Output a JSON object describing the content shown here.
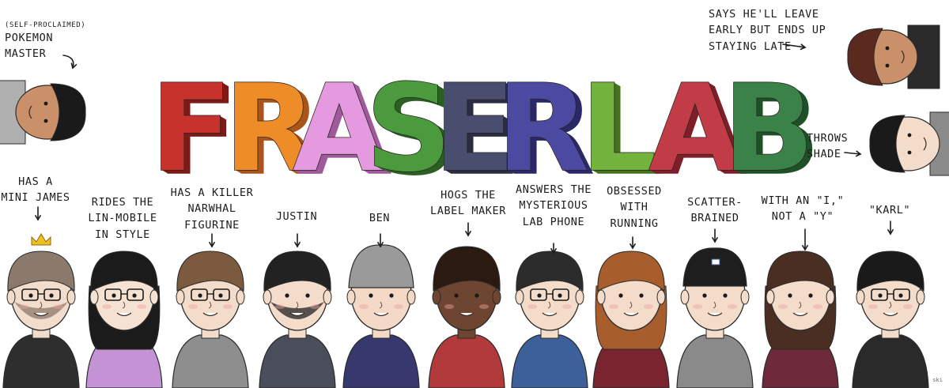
{
  "title": {
    "letters": [
      {
        "ch": "F",
        "color": "#c8322c",
        "side": "#7e1a17"
      },
      {
        "ch": "R",
        "color": "#ee8c28",
        "side": "#a9551a"
      },
      {
        "ch": "A",
        "color": "#e59ae0",
        "side": "#9e5b9b"
      },
      {
        "ch": "S",
        "color": "#4c9a3e",
        "side": "#2c5f24"
      },
      {
        "ch": "E",
        "color": "#4a4e6e",
        "side": "#2a2c42"
      },
      {
        "ch": "R",
        "color": "#4b4aa0",
        "side": "#2a2968"
      },
      {
        "ch": "L",
        "color": "#72b33e",
        "side": "#44731f"
      },
      {
        "ch": "A",
        "color": "#c23c48",
        "side": "#7e1f28"
      },
      {
        "ch": "B",
        "color": "#3a8248",
        "side": "#1f5129"
      }
    ]
  },
  "captions": {
    "pokemon_prefix": "(SELF-PROCLAIMED)",
    "pokemon": "POKEMON\nMASTER",
    "leave_late": "SAYS HE'LL LEAVE\nEARLY BUT ENDS UP\nSTAYING LATE",
    "shade": "THROWS\nSHADE",
    "mini_james": "HAS A\nMINI JAMES",
    "lin_mobile": "RIDES THE\nLIN-MOBILE\nIN STYLE",
    "narwhal": "HAS A KILLER\nNARWHAL\nFIGURINE",
    "justin": "JUSTIN",
    "ben": "BEN",
    "label_maker": "HOGS THE\nLABEL MAKER",
    "lab_phone": "ANSWERS THE\nMYSTERIOUS\nLAB PHONE",
    "running": "OBSESSED\nWITH\nRUNNING",
    "scatter": "SCATTER-\nBRAINED",
    "with_i": "WITH AN \"I,\"\nNOT A \"Y\"",
    "karl": "\"KARL\""
  },
  "signature": "ski",
  "people": [
    {
      "skin": "#f2dccb",
      "hair": "#8b7a6c",
      "shirt": "#2e2e2e",
      "beard": true,
      "glasses": true,
      "crown": true
    },
    {
      "skin": "#f6e2d2",
      "hair": "#1b1b1b",
      "shirt": "#c493d6",
      "glasses": true,
      "long": true
    },
    {
      "skin": "#f4dccb",
      "hair": "#7b5a3e",
      "shirt": "#8e8e8e",
      "glasses": true
    },
    {
      "skin": "#f4dccb",
      "hair": "#222222",
      "shirt": "#4a4d5a",
      "beard": true
    },
    {
      "skin": "#f3d9c6",
      "hair": "#9a9a9a",
      "shirt": "#36386e",
      "beanie": true
    },
    {
      "skin": "#6e4530",
      "hair": "#2a1a12",
      "shirt": "#b33a3a",
      "curly": true
    },
    {
      "skin": "#f4dccb",
      "hair": "#2c2c2c",
      "shirt": "#3d5f9a",
      "glasses": true
    },
    {
      "skin": "#f4dccb",
      "hair": "#a85e2c",
      "shirt": "#7a2430",
      "wavy": true
    },
    {
      "skin": "#f4dccb",
      "hair": "#1e1e1e",
      "shirt": "#8a8a8a",
      "cap": true
    },
    {
      "skin": "#f4dccb",
      "hair": "#4a2e22",
      "shirt": "#6e2a3a",
      "long": true
    },
    {
      "skin": "#f4dccb",
      "hair": "#1a1a1a",
      "shirt": "#2a2a2a",
      "glasses": true
    }
  ]
}
